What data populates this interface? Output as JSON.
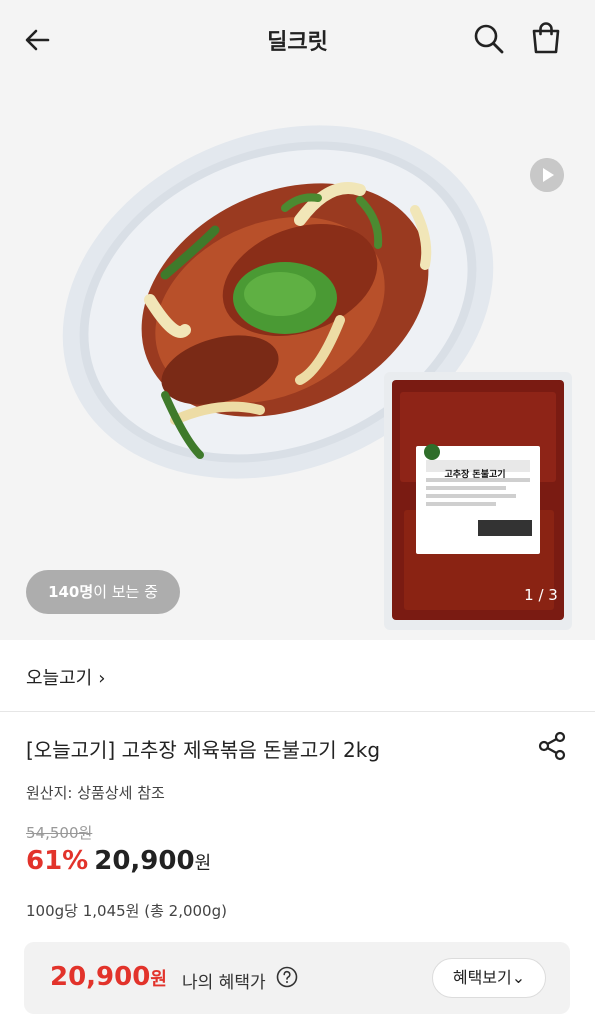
{
  "header": {
    "title": "딜크릿",
    "back_icon": "arrow-left-icon",
    "search_icon": "search-icon",
    "cart_icon": "shopping-bag-icon"
  },
  "hero": {
    "viewers_count": "140명",
    "viewers_suffix": "이 보는 중",
    "page_indicator": "1 / 3",
    "package_label": "고추장 돈불고기",
    "play_icon": "play-icon"
  },
  "brand": {
    "name": "오늘고기",
    "chevron": "›"
  },
  "product": {
    "title": "[오늘고기] 고추장 제육볶음 돈불고기 2kg",
    "origin": "원산지: 상품상세 참조",
    "original_price": "54,500원",
    "discount": "61%",
    "price": "20,900",
    "price_unit": "원",
    "unit_price": "100g당 1,045원 (총 2,000g)"
  },
  "benefit": {
    "price": "20,900",
    "price_unit": "원",
    "label": "나의 혜택가",
    "button_label": "혜택보기",
    "button_chevron": "⌄"
  },
  "colors": {
    "accent_red": "#e2332b",
    "background_gray": "#f4f4f4"
  }
}
